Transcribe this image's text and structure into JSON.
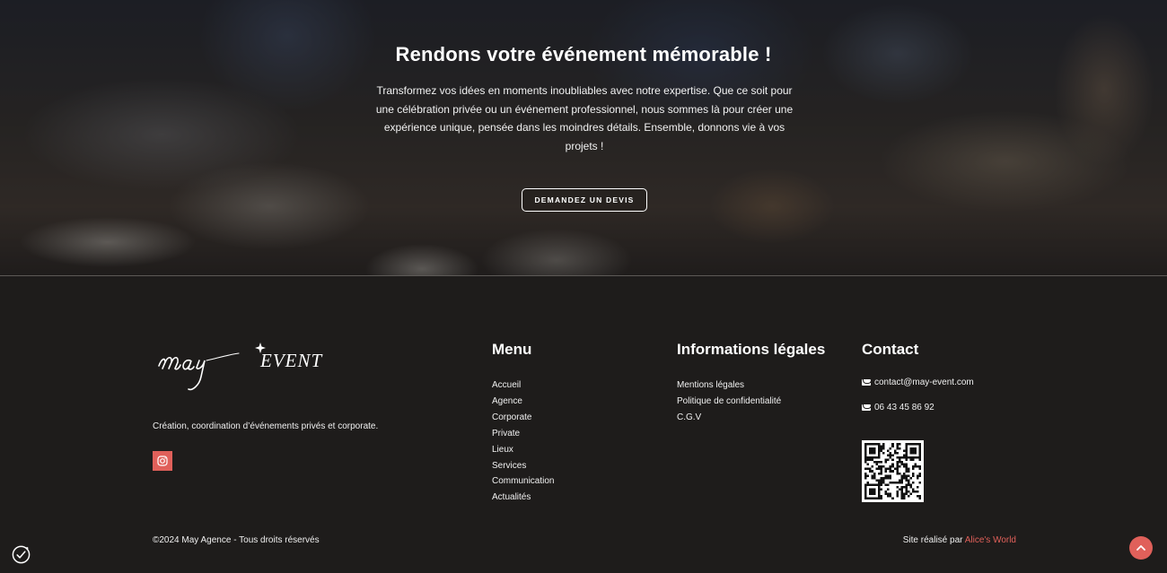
{
  "hero": {
    "title": "Rendons votre événement mémorable !",
    "text": "Transformez vos idées en moments inoubliables avec notre expertise. Que ce soit pour une célébration privée ou un événement professionnel, nous sommes là pour créer une expérience unique, pensée dans les moindres détails. Ensemble, donnons vie à vos projets !",
    "button_label": "DEMANDEZ UN DEVIS"
  },
  "brand": {
    "logo_script": "may",
    "logo_word": "EVENT",
    "tagline": "Création, coordination d’événements privés et corporate.",
    "social_icon": "instagram-icon",
    "accent_color": "#e0605a"
  },
  "menu": {
    "title": "Menu",
    "items": [
      "Accueil",
      "Agence",
      "Corporate",
      "Private",
      "Lieux",
      "Services",
      "Communication",
      "Actualités"
    ]
  },
  "legal": {
    "title": "Informations légales",
    "items": [
      "Mentions légales",
      "Politique de confidentialité",
      "C.G.V"
    ]
  },
  "contact": {
    "title": "Contact",
    "email": "contact@may-event.com",
    "phone": "06 43 45 86 92",
    "qr_icon": "qr-code"
  },
  "bottom": {
    "copyright": "©2024 May Agence - Tous droits réservés",
    "credit_prefix": "Site réalisé par ",
    "credit_link": "Alice's World"
  }
}
